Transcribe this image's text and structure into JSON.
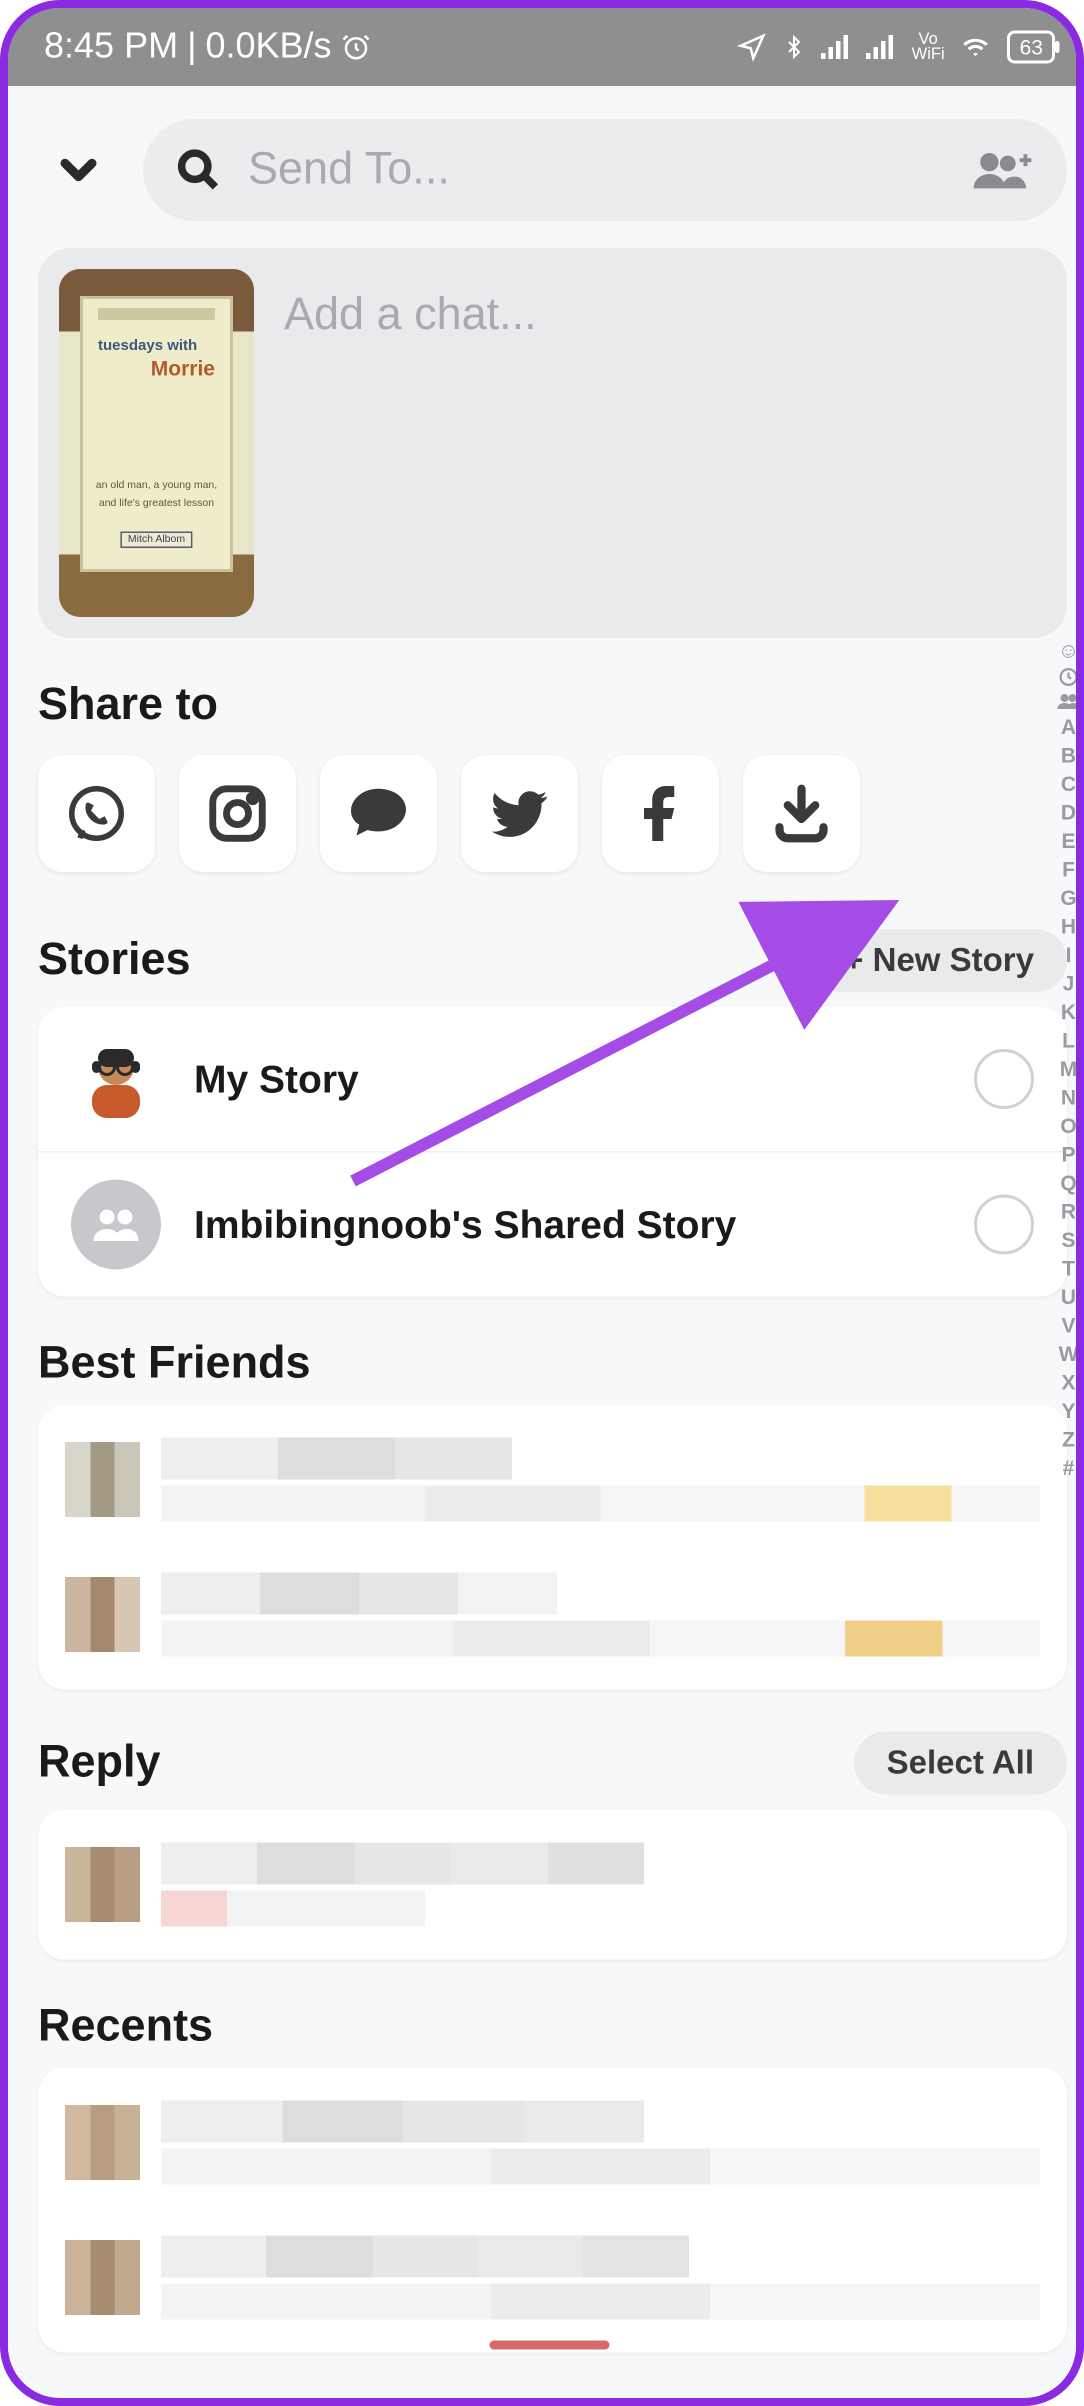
{
  "status": {
    "time": "8:45 PM",
    "net_speed": "0.0KB/s",
    "battery": "63",
    "vowifi_top": "Vo",
    "vowifi_bot": "WiFi"
  },
  "search": {
    "placeholder": "Send To..."
  },
  "chat": {
    "placeholder": "Add a chat...",
    "book_line1": "tuesdays with",
    "book_line2": "Morrie",
    "book_sub1": "an old man, a young man,",
    "book_sub2": "and life's greatest lesson",
    "book_author": "Mitch Albom"
  },
  "sections": {
    "share_title": "Share to",
    "stories_title": "Stories",
    "new_story_btn": "+ New Story",
    "best_friends_title": "Best Friends",
    "reply_title": "Reply",
    "select_all_btn": "Select All",
    "recents_title": "Recents"
  },
  "share_icons": [
    "whatsapp",
    "instagram",
    "messages",
    "twitter",
    "facebook",
    "download"
  ],
  "stories": {
    "my_story": "My Story",
    "shared_story": "Imbibingnoob's Shared Story"
  },
  "alpha_index": [
    "A",
    "B",
    "C",
    "D",
    "E",
    "F",
    "G",
    "H",
    "I",
    "J",
    "K",
    "L",
    "M",
    "N",
    "O",
    "P",
    "Q",
    "R",
    "S",
    "T",
    "U",
    "V",
    "W",
    "X",
    "Y",
    "Z",
    "#"
  ]
}
